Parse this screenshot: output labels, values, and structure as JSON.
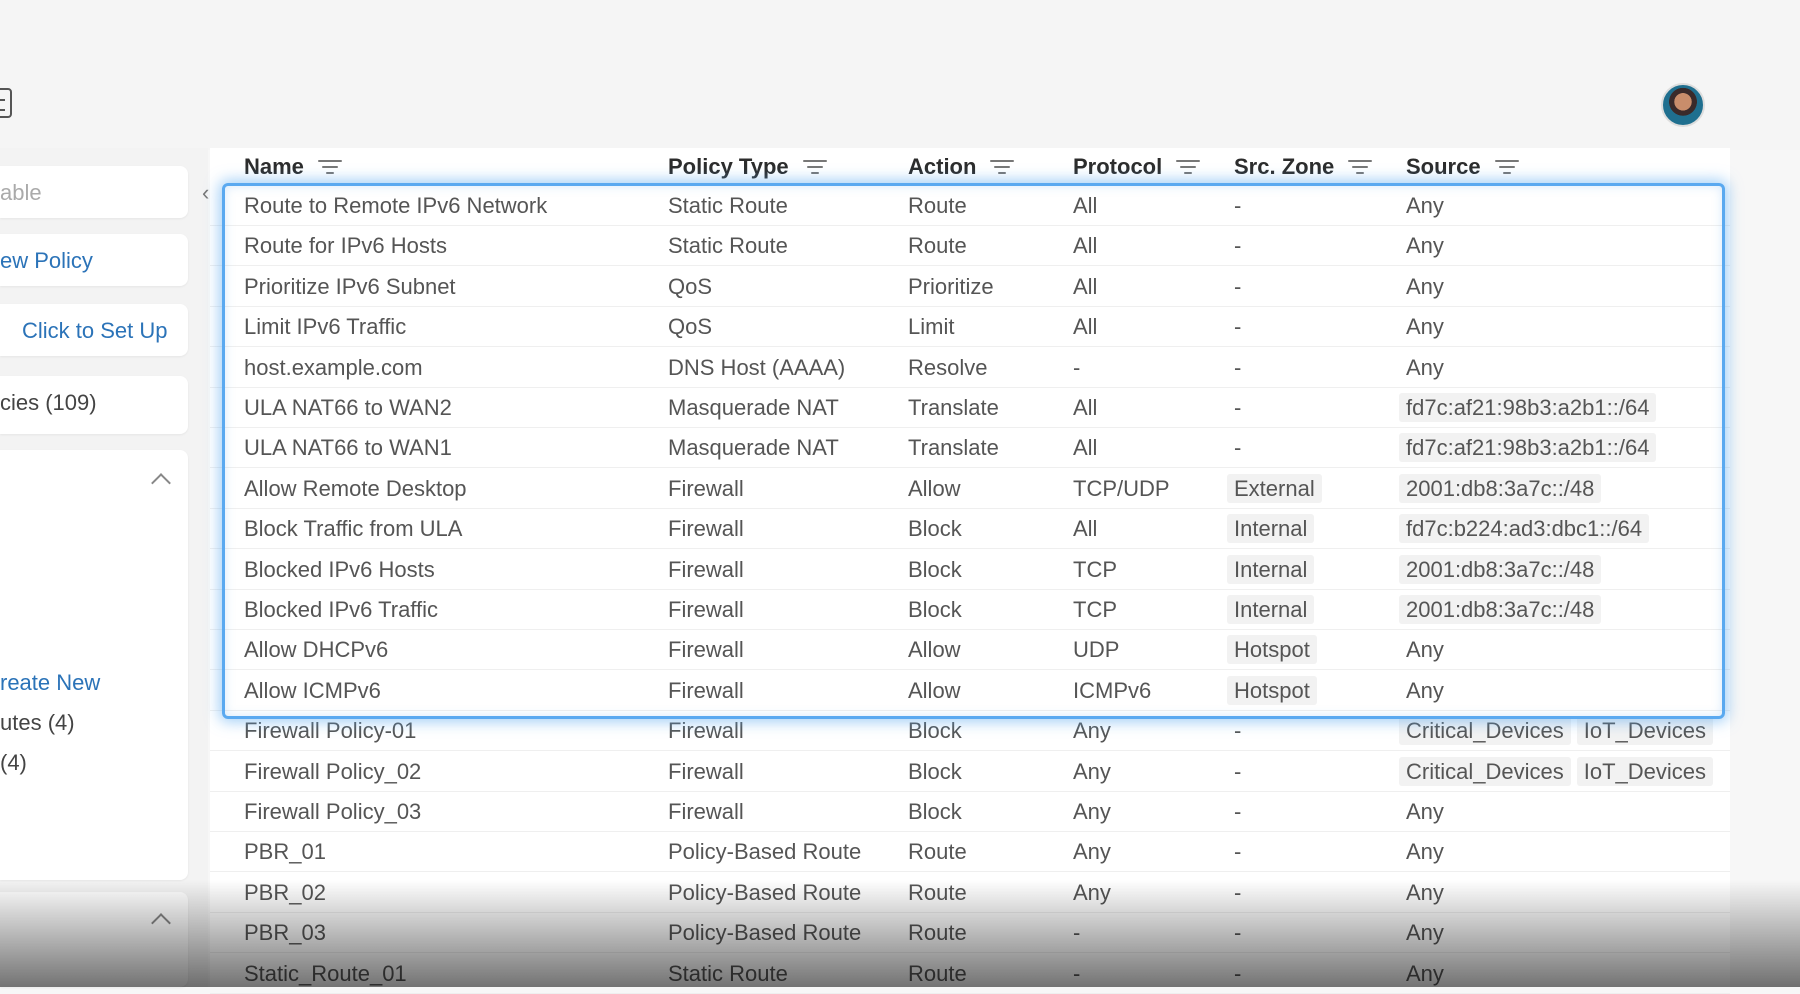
{
  "sidebar": {
    "search_placeholder": "able",
    "new_policy": "ew Policy",
    "setup_link": "Click to Set Up",
    "policies_count": "cies (109)",
    "create_new": "reate New",
    "routes_count": "utes (4)",
    "other_count": "(4)"
  },
  "table": {
    "columns": [
      "Name",
      "Policy Type",
      "Action",
      "Protocol",
      "Src. Zone",
      "Source"
    ],
    "rows": [
      {
        "name": "Route to Remote IPv6 Network",
        "type": "Static Route",
        "action": "Route",
        "protocol": "All",
        "zone": "-",
        "source": "Any"
      },
      {
        "name": "Route for IPv6 Hosts",
        "type": "Static Route",
        "action": "Route",
        "protocol": "All",
        "zone": "-",
        "source": "Any"
      },
      {
        "name": "Prioritize IPv6 Subnet",
        "type": "QoS",
        "action": "Prioritize",
        "protocol": "All",
        "zone": "-",
        "source": "Any"
      },
      {
        "name": "Limit IPv6 Traffic",
        "type": "QoS",
        "action": "Limit",
        "protocol": "All",
        "zone": "-",
        "source": "Any"
      },
      {
        "name": "host.example.com",
        "type": "DNS Host (AAAA)",
        "action": "Resolve",
        "protocol": "-",
        "zone": "-",
        "source": "Any"
      },
      {
        "name": "ULA NAT66 to WAN2",
        "type": "Masquerade NAT",
        "action": "Translate",
        "protocol": "All",
        "zone": "-",
        "source": "fd7c:af21:98b3:a2b1::/64"
      },
      {
        "name": "ULA NAT66 to WAN1",
        "type": "Masquerade NAT",
        "action": "Translate",
        "protocol": "All",
        "zone": "-",
        "source": "fd7c:af21:98b3:a2b1::/64"
      },
      {
        "name": "Allow Remote Desktop",
        "type": "Firewall",
        "action": "Allow",
        "protocol": "TCP/UDP",
        "zone": "External",
        "source": "2001:db8:3a7c::/48"
      },
      {
        "name": "Block Traffic from ULA",
        "type": "Firewall",
        "action": "Block",
        "protocol": "All",
        "zone": "Internal",
        "source": "fd7c:b224:ad3:dbc1::/64"
      },
      {
        "name": "Blocked IPv6 Hosts",
        "type": "Firewall",
        "action": "Block",
        "protocol": "TCP",
        "zone": "Internal",
        "source": "2001:db8:3a7c::/48"
      },
      {
        "name": "Blocked IPv6 Traffic",
        "type": "Firewall",
        "action": "Block",
        "protocol": "TCP",
        "zone": "Internal",
        "source": "2001:db8:3a7c::/48"
      },
      {
        "name": "Allow DHCPv6",
        "type": "Firewall",
        "action": "Allow",
        "protocol": "UDP",
        "zone": "Hotspot",
        "source": "Any"
      },
      {
        "name": "Allow ICMPv6",
        "type": "Firewall",
        "action": "Allow",
        "protocol": "ICMPv6",
        "zone": "Hotspot",
        "source": "Any"
      },
      {
        "name": "Firewall Policy-01",
        "type": "Firewall",
        "action": "Block",
        "protocol": "Any",
        "zone": "-",
        "source": "Critical_Devices",
        "source2": "IoT_Devices"
      },
      {
        "name": "Firewall Policy_02",
        "type": "Firewall",
        "action": "Block",
        "protocol": "Any",
        "zone": "-",
        "source": "Critical_Devices",
        "source2": "IoT_Devices"
      },
      {
        "name": "Firewall Policy_03",
        "type": "Firewall",
        "action": "Block",
        "protocol": "Any",
        "zone": "-",
        "source": "Any"
      },
      {
        "name": "PBR_01",
        "type": "Policy-Based Route",
        "action": "Route",
        "protocol": "Any",
        "zone": "-",
        "source": "Any"
      },
      {
        "name": "PBR_02",
        "type": "Policy-Based Route",
        "action": "Route",
        "protocol": "Any",
        "zone": "-",
        "source": "Any"
      },
      {
        "name": "PBR_03",
        "type": "Policy-Based Route",
        "action": "Route",
        "protocol": "-",
        "zone": "-",
        "source": "Any"
      },
      {
        "name": "Static_Route_01",
        "type": "Static Route",
        "action": "Route",
        "protocol": "-",
        "zone": "-",
        "source": "Any"
      }
    ]
  }
}
